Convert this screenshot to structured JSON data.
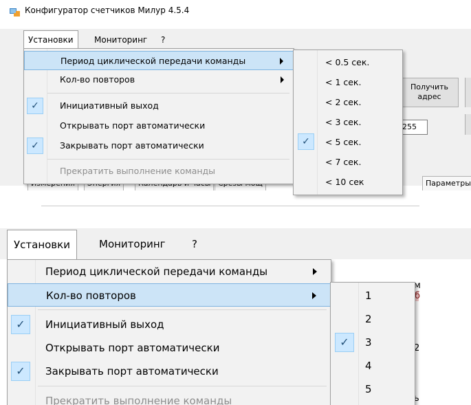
{
  "panel1": {
    "window_title": "Конфигуратор счетчиков Милур 4.5.4",
    "menubar": [
      "Установки",
      "Мониторинг",
      "?"
    ],
    "menu_items": [
      {
        "label": "Период циклической передачи команды",
        "submenu": true,
        "highlighted": true,
        "checked": false,
        "disabled": false
      },
      {
        "label": "Кол-во повторов",
        "submenu": true,
        "highlighted": false,
        "checked": false,
        "disabled": false
      },
      {
        "label": "Инициативный выход",
        "submenu": false,
        "highlighted": false,
        "checked": true,
        "disabled": false
      },
      {
        "label": "Открывать порт автоматически",
        "submenu": false,
        "highlighted": false,
        "checked": false,
        "disabled": false
      },
      {
        "label": "Закрывать порт автоматически",
        "submenu": false,
        "highlighted": false,
        "checked": true,
        "disabled": false
      },
      {
        "label": "Прекратить выполнение команды",
        "submenu": false,
        "highlighted": false,
        "checked": false,
        "disabled": true
      }
    ],
    "submenu_items": [
      "< 0.5 сек.",
      "< 1 сек.",
      "< 2 сек.",
      "< 3 сек.",
      "< 5 сек.",
      "< 7 сек.",
      "< 10 сек"
    ],
    "submenu_checked_index": 4,
    "background": {
      "button_get_address": "Получить адрес",
      "field_value": "255",
      "tabs": [
        "Измерения",
        "Энергия",
        "Календарь и часы",
        "Срезы мощ",
        "Параметры"
      ]
    }
  },
  "panel2": {
    "menubar": [
      "Установки",
      "Мониторинг",
      "?"
    ],
    "menu_items": [
      {
        "label": "Период циклической передачи команды",
        "submenu": true,
        "highlighted": false,
        "checked": false,
        "disabled": false
      },
      {
        "label": "Кол-во повторов",
        "submenu": true,
        "highlighted": true,
        "checked": false,
        "disabled": false
      },
      {
        "label": "Инициативный выход",
        "submenu": false,
        "highlighted": false,
        "checked": true,
        "disabled": false
      },
      {
        "label": "Открывать порт автоматически",
        "submenu": false,
        "highlighted": false,
        "checked": false,
        "disabled": false
      },
      {
        "label": "Закрывать порт автоматически",
        "submenu": false,
        "highlighted": false,
        "checked": true,
        "disabled": false
      },
      {
        "label": "Прекратить выполнение команды",
        "submenu": false,
        "highlighted": false,
        "checked": false,
        "disabled": true
      }
    ],
    "submenu_items": [
      "1",
      "2",
      "3",
      "4",
      "5"
    ],
    "submenu_checked_index": 2,
    "peek_letters": [
      "м",
      "б",
      "2",
      "ь"
    ]
  },
  "colors": {
    "highlight": "#cce4f7",
    "highlight_border": "#7fb4e0",
    "check_bg": "#cce8ff",
    "disabled_text": "#8d8d8d",
    "menu_bg": "#f2f2f2"
  }
}
